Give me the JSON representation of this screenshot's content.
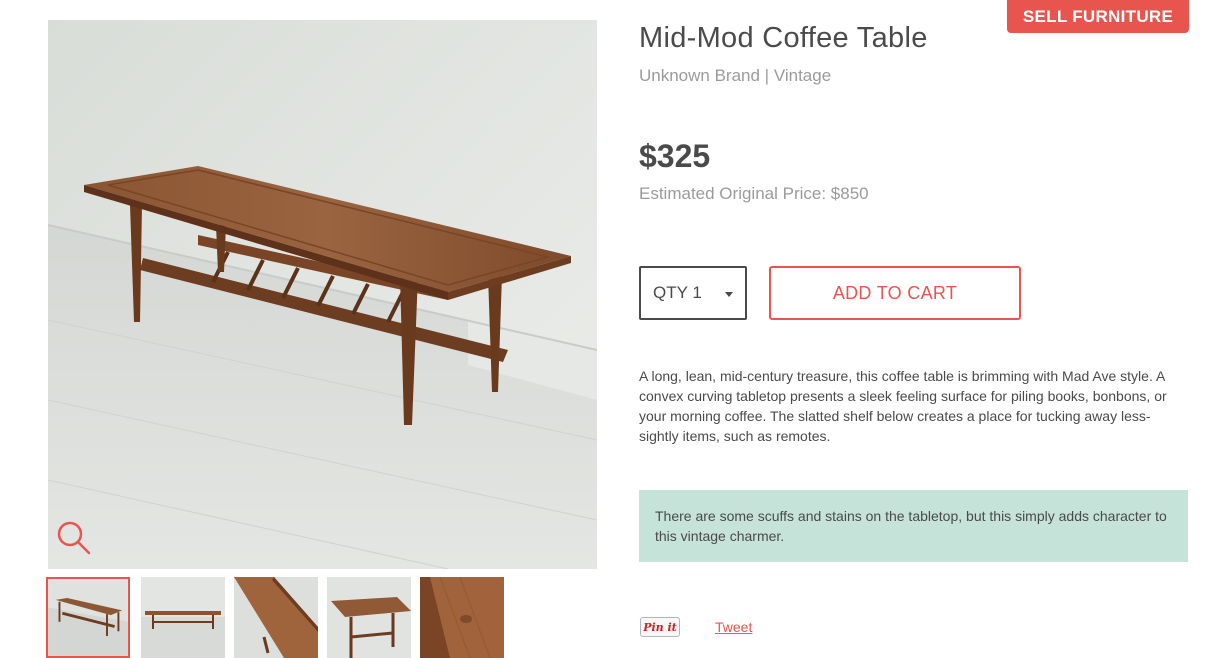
{
  "header": {
    "sell_button": "SELL FURNITURE"
  },
  "gallery": {
    "main_image_alt": "Mid-Mod Coffee Table",
    "zoom_icon": "search-icon",
    "thumbnails": [
      {
        "alt": "Coffee table angled view",
        "active": true
      },
      {
        "alt": "Coffee table side view",
        "active": false
      },
      {
        "alt": "Tabletop corner detail",
        "active": false
      },
      {
        "alt": "Table end view",
        "active": false
      },
      {
        "alt": "Wood grain detail",
        "active": false
      }
    ]
  },
  "product": {
    "title": "Mid-Mod Coffee Table",
    "subtitle": "Unknown Brand | Vintage",
    "price": "$325",
    "original_price": "Estimated Original Price: $850",
    "quantity": "QTY 1",
    "add_to_cart": "ADD TO CART",
    "description": "A long, lean, mid-century treasure, this coffee table is brimming with Mad Ave style. A convex curving tabletop presents a sleek feeling surface for piling books, bonbons, or your morning coffee. The slatted shelf below creates a place for tucking away less-sightly items, such as remotes.",
    "condition_note": "There are some scuffs and stains on the tabletop, but this simply adds character to this vintage charmer."
  },
  "social": {
    "pin_label": "Pin it",
    "tweet_label": "Tweet"
  },
  "colors": {
    "accent": "#e8554e",
    "note_bg": "#c5e3d8",
    "text": "#4a4a4a",
    "muted": "#9b9b9b"
  }
}
